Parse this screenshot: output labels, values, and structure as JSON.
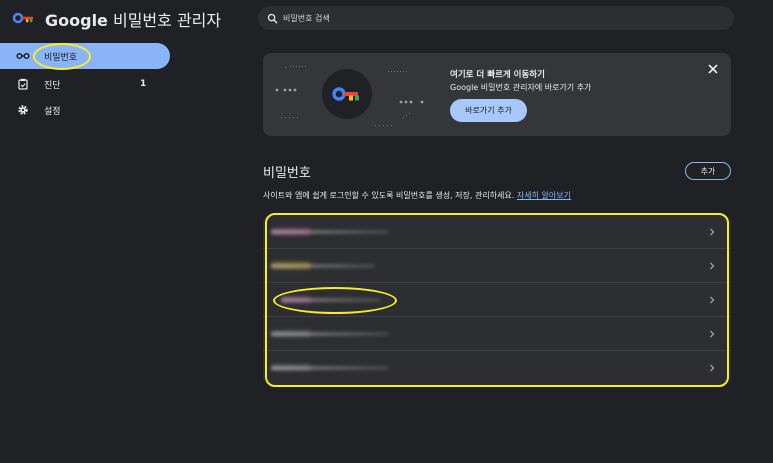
{
  "header": {
    "title_brand": "Google",
    "title_rest": " 비밀번호 관리자",
    "search_placeholder": "비밀번호 검색"
  },
  "sidebar": {
    "items": [
      {
        "label": "비밀번호",
        "icon": "key-icon",
        "active": true
      },
      {
        "label": "진단",
        "icon": "checkup-icon",
        "count": "1"
      },
      {
        "label": "설정",
        "icon": "gear-icon"
      }
    ]
  },
  "promo": {
    "title": "여기로 더 빠르게 이동하기",
    "description": "Google 비밀번호 관리자에 바로가기 추가",
    "button_label": "바로가기 추가"
  },
  "section": {
    "title": "비밀번호",
    "add_label": "추가",
    "description": "사이트와 앱에 쉽게 로그인할 수 있도록 비밀번호를 생성, 저장, 관리하세요. ",
    "learn_more": "자세히 알아보기"
  },
  "passwords": {
    "count": 5,
    "favicon_colors": [
      "#c05a9a",
      "#c8a020",
      "#c05a9a",
      "#8a8a8a",
      "#8a8a8a"
    ]
  },
  "colors": {
    "accent": "#8ab4f8",
    "highlight": "#f7ee2a",
    "background": "#202124"
  }
}
